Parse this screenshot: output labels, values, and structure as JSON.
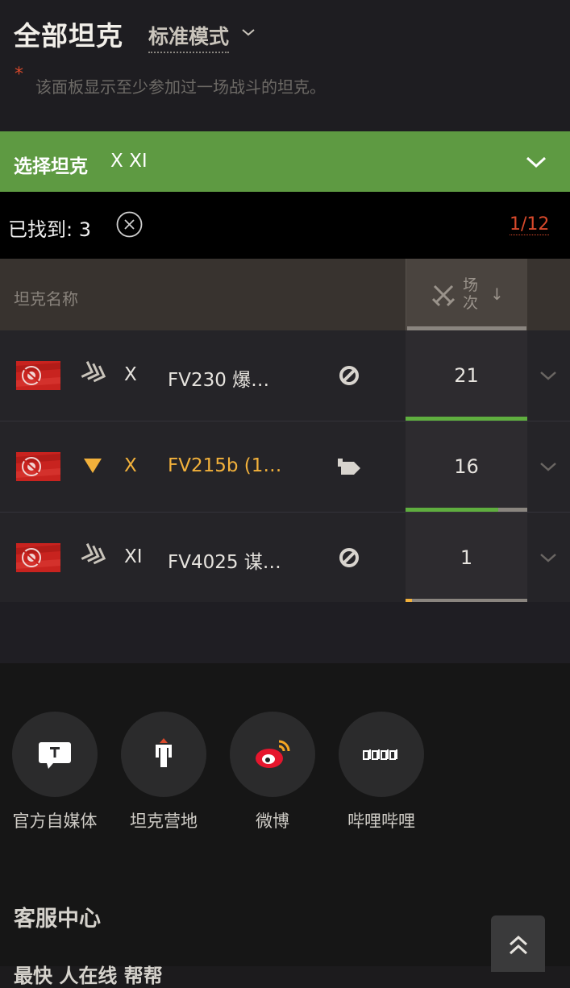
{
  "header": {
    "title": "全部坦克",
    "mode": "标准模式",
    "note_star": "*",
    "note": "该面板显示至少参加过一场战斗的坦克。"
  },
  "filter": {
    "label": "选择坦克",
    "tiers": "X XI"
  },
  "results": {
    "found": "已找到: 3",
    "page": "1/12"
  },
  "table": {
    "col_name": "坦克名称",
    "col_battles": "场次",
    "col_sort_arrow": "↓",
    "rows": [
      {
        "tier": "X",
        "name": "FV230 爆…",
        "battles": "21",
        "battles_fraction": 1.0,
        "premium": false,
        "class_icon": "heavy-tank-icon",
        "type_icon": "autoloader-icon"
      },
      {
        "tier": "X",
        "name": "FV215b (1…",
        "battles": "16",
        "battles_fraction": 0.76,
        "premium": true,
        "class_icon": "premium-tank-icon",
        "type_icon": "tank-destroyer-icon"
      },
      {
        "tier": "XI",
        "name": "FV4025 谋…",
        "battles": "1",
        "battles_fraction": 0.05,
        "premium": false,
        "class_icon": "heavy-tank-icon",
        "type_icon": "autoloader-icon"
      }
    ]
  },
  "colors": {
    "accent_green": "#5e9a42",
    "gold": "#f2b13b",
    "red": "#d8492b",
    "bar_green": "#5fae3f",
    "bar_yellow": "#f2b13b"
  },
  "footer": {
    "social": [
      {
        "label": "官方自媒体",
        "icon": "official-media-icon"
      },
      {
        "label": "坦克营地",
        "icon": "tank-camp-icon"
      },
      {
        "label": "微博",
        "icon": "weibo-icon"
      },
      {
        "label": "哔哩哔哩",
        "icon": "bilibili-icon"
      }
    ],
    "service_title": "客服中心",
    "cut_text": "最快 人在线 帮帮"
  }
}
